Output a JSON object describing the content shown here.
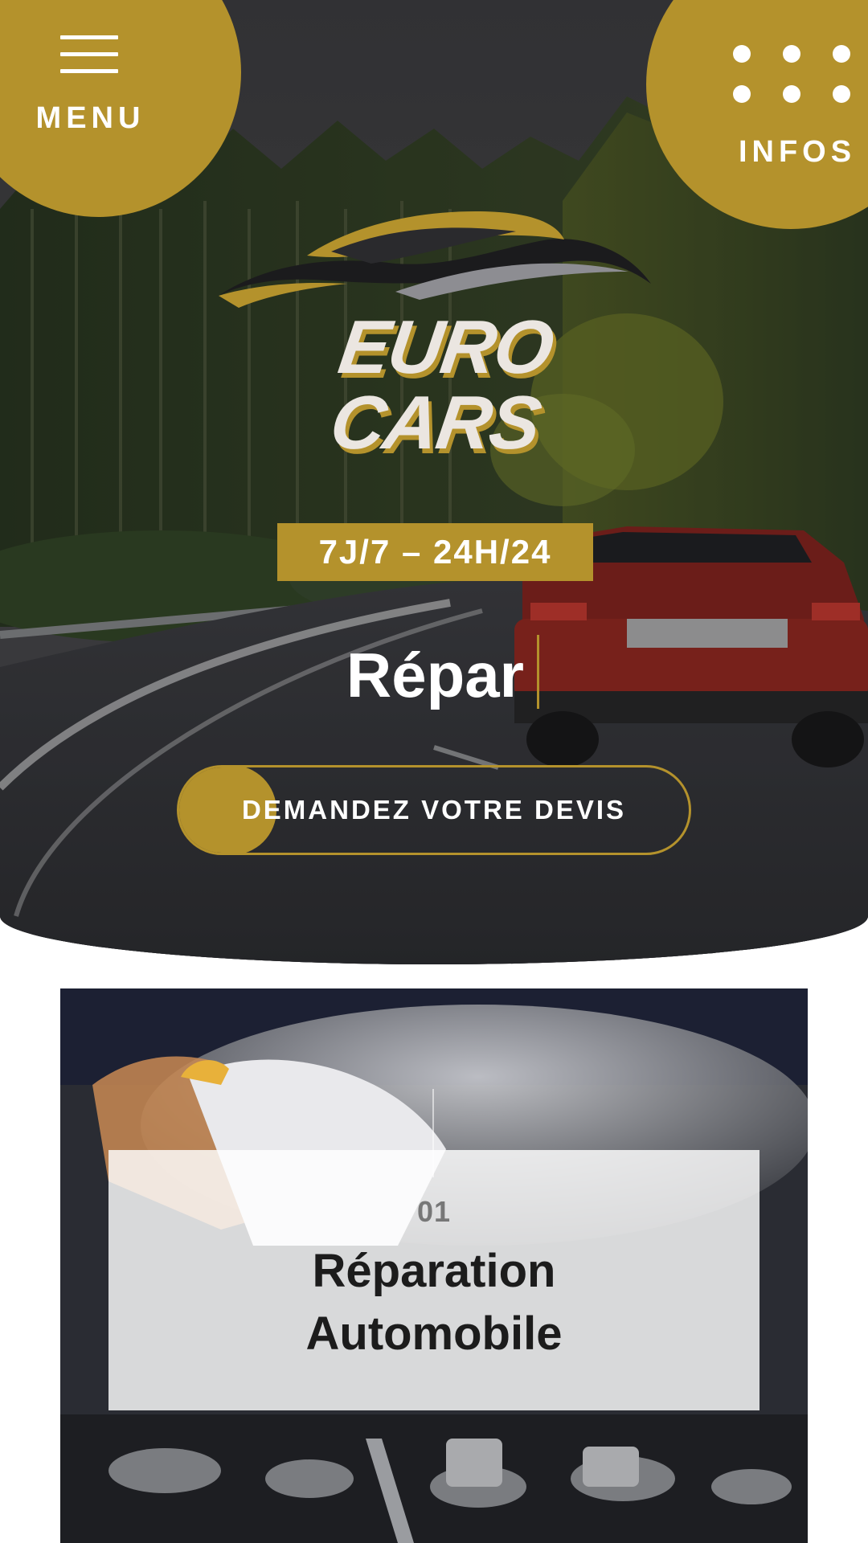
{
  "header": {
    "menu_label": "MENU",
    "infos_label": "INFOS"
  },
  "brand": {
    "logo_text": "EURO CARS",
    "accent_color": "#b4922c"
  },
  "hero": {
    "hours_badge": "7J/7 – 24H/24",
    "typed_text": "Répar",
    "cta_label": "DEMANDEZ VOTRE DEVIS"
  },
  "service": {
    "number": "01",
    "title_line1": "Réparation",
    "title_line2": "Automobile"
  },
  "icons": {
    "menu": "hamburger-icon",
    "infos": "dots-grid-icon",
    "logo": "car-swoosh-logo"
  }
}
